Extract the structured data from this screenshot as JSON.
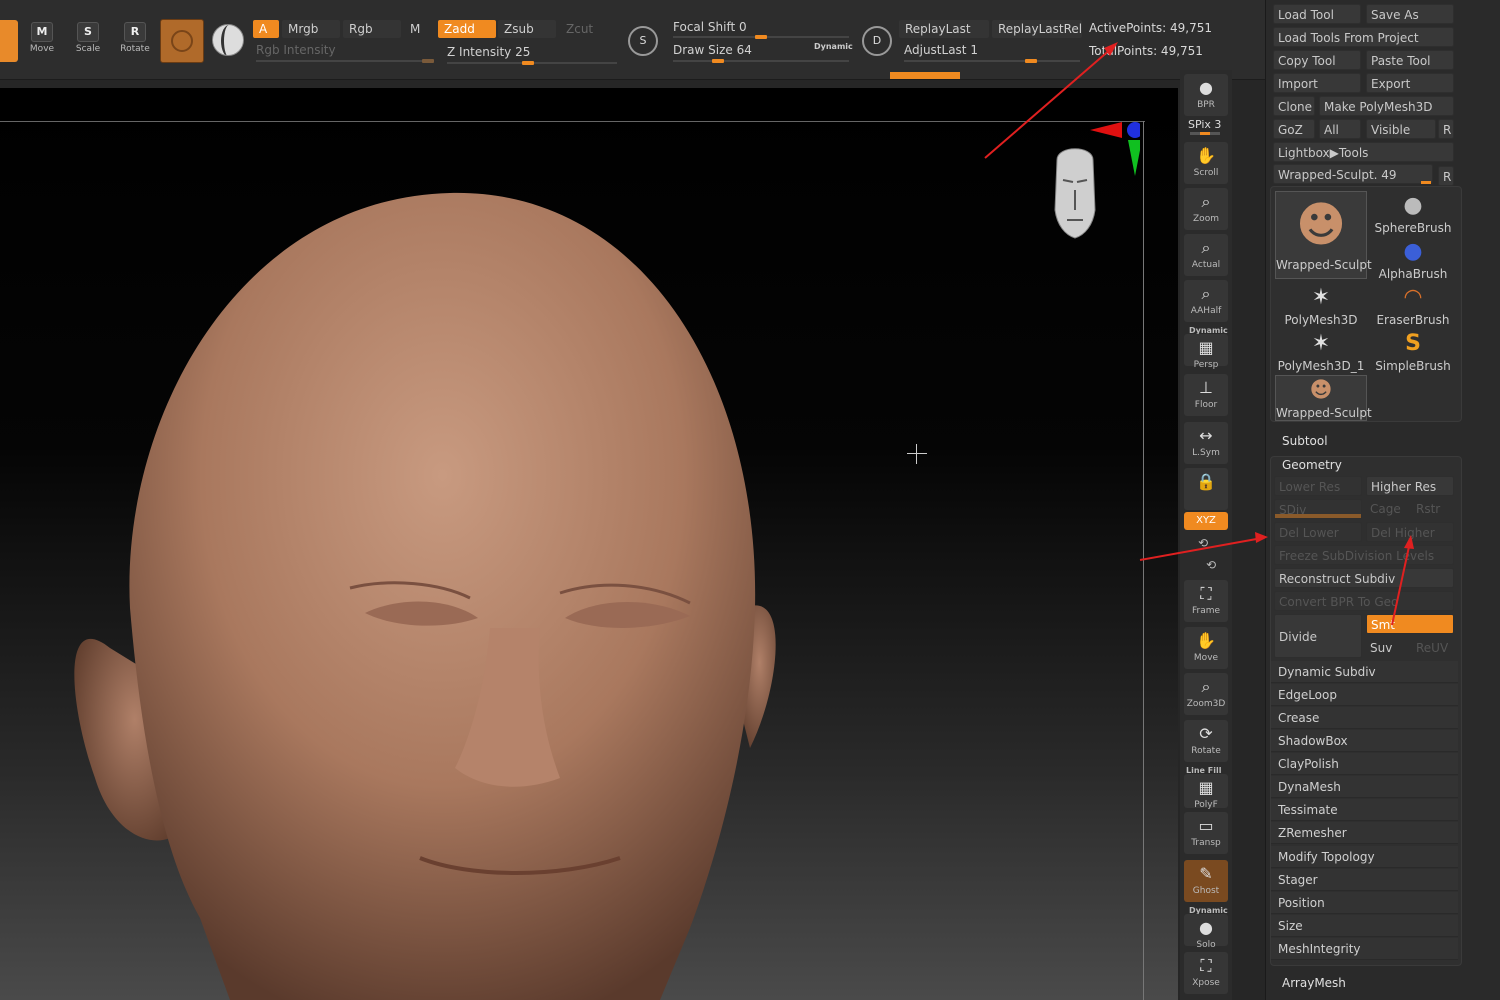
{
  "toolbar": {
    "transform_buttons": [
      {
        "label": "Move",
        "glyph": "M",
        "icon": "move-icon"
      },
      {
        "label": "Scale",
        "glyph": "S",
        "icon": "scale-icon"
      },
      {
        "label": "Rotate",
        "glyph": "R",
        "icon": "rotate-icon"
      }
    ],
    "rgb_segments": {
      "a": "A",
      "mrgb": "Mrgb",
      "rgb": "Rgb",
      "m": "M"
    },
    "rgb_intensity_label": "Rgb Intensity",
    "z_segments": {
      "zadd": "Zadd",
      "zsub": "Zsub",
      "zcut": "Zcut"
    },
    "z_intensity_label": "Z Intensity 25",
    "z_intensity_value": 25,
    "symmetry_s": "S",
    "focal_shift_label": "Focal Shift 0",
    "draw_size_label": "Draw Size 64",
    "dynamic_label": "Dynamic",
    "replay_d": "D",
    "replay_last": "ReplayLast",
    "replay_last_rel": "ReplayLastRel",
    "adjust_last": "AdjustLast 1",
    "active_points": "ActivePoints: 49,751",
    "total_points": "TotalPoints: 49,751"
  },
  "shelf": {
    "spix_label": "SPix 3",
    "buttons": [
      {
        "name": "bpr-button",
        "label": "BPR",
        "glyph": "●"
      },
      {
        "name": "scroll-button",
        "label": "Scroll",
        "glyph": "✋"
      },
      {
        "name": "zoom-button",
        "label": "Zoom",
        "glyph": "⌕"
      },
      {
        "name": "actual-button",
        "label": "Actual",
        "glyph": "⌕"
      },
      {
        "name": "aahalf-button",
        "label": "AAHalf",
        "glyph": "⌕"
      },
      {
        "name": "persp-button",
        "label": "Persp",
        "glyph": "▦"
      },
      {
        "name": "floor-button",
        "label": "Floor",
        "glyph": "⊥"
      },
      {
        "name": "lsym-button",
        "label": "L.Sym",
        "glyph": "↔"
      },
      {
        "name": "lock-button",
        "label": "",
        "glyph": "🔒"
      },
      {
        "name": "xyz-button",
        "label": "XYZ",
        "glyph": ""
      },
      {
        "name": "frame-button",
        "label": "Frame",
        "glyph": "⛶"
      },
      {
        "name": "move3d-button",
        "label": "Move",
        "glyph": "✋"
      },
      {
        "name": "zoom3d-button",
        "label": "Zoom3D",
        "glyph": "⌕"
      },
      {
        "name": "rotate3d-button",
        "label": "Rotate",
        "glyph": "⟳"
      },
      {
        "name": "polyf-button",
        "label": "PolyF",
        "glyph": "▦"
      },
      {
        "name": "transp-button",
        "label": "Transp",
        "glyph": "▭"
      },
      {
        "name": "ghost-button",
        "label": "Ghost",
        "glyph": "✎"
      },
      {
        "name": "solo-button",
        "label": "Solo",
        "glyph": "●"
      },
      {
        "name": "xpose-button",
        "label": "Xpose",
        "glyph": "⛶"
      }
    ],
    "dynamic_label": "Dynamic",
    "line_fill_label": "Line Fill"
  },
  "panel": {
    "load_tool": "Load Tool",
    "save_as": "Save As",
    "load_tools_from_project": "Load Tools From Project",
    "copy_tool": "Copy Tool",
    "paste_tool": "Paste Tool",
    "import": "Import",
    "export": "Export",
    "clone": "Clone",
    "make_polymesh": "Make PolyMesh3D",
    "goz": "GoZ",
    "all": "All",
    "visible": "Visible",
    "r": "R",
    "lightbox_tools": "Lightbox▶Tools",
    "current_tool": "Wrapped-Sculpt. 49",
    "tools": [
      {
        "name": "Wrapped-Sculpt",
        "glyph": "☻",
        "color": "#c8906a"
      },
      {
        "name": "SphereBrush",
        "glyph": "●",
        "color": "#bbbbbb"
      },
      {
        "name": "AlphaBrush",
        "glyph": "●",
        "color": "#3b5fd8"
      },
      {
        "name": "PolyMesh3D",
        "glyph": "✶",
        "color": "#e0e0e0"
      },
      {
        "name": "EraserBrush",
        "glyph": "◠",
        "color": "#d8702a"
      },
      {
        "name": "PolyMesh3D_1",
        "glyph": "✶",
        "color": "#e0e0e0"
      },
      {
        "name": "SimpleBrush",
        "glyph": "S",
        "color": "#f0a020"
      },
      {
        "name": "Wrapped-Sculpt",
        "glyph": "☻",
        "color": "#c8906a"
      }
    ],
    "subtool": "Subtool",
    "geometry": "Geometry",
    "lower_res": "Lower Res",
    "higher_res": "Higher Res",
    "sdiv": "SDiv",
    "cage": "Cage",
    "rstr": "Rstr",
    "del_lower": "Del Lower",
    "del_higher": "Del Higher",
    "freeze_subdivision": "Freeze SubDivision Levels",
    "reconstruct_subdiv": "Reconstruct Subdiv",
    "convert_bpr": "Convert BPR To Geo",
    "divide": "Divide",
    "smt": "Smt",
    "suv": "Suv",
    "reuv": "ReUV",
    "menu": [
      "Dynamic Subdiv",
      "EdgeLoop",
      "Crease",
      "ShadowBox",
      "ClayPolish",
      "DynaMesh",
      "Tessimate",
      "ZRemesher",
      "Modify Topology",
      "Stager",
      "Position",
      "Size",
      "MeshIntegrity"
    ],
    "arraymesh": "ArrayMesh"
  },
  "colors": {
    "accent": "#f08a20",
    "annotation": "#e02020"
  }
}
